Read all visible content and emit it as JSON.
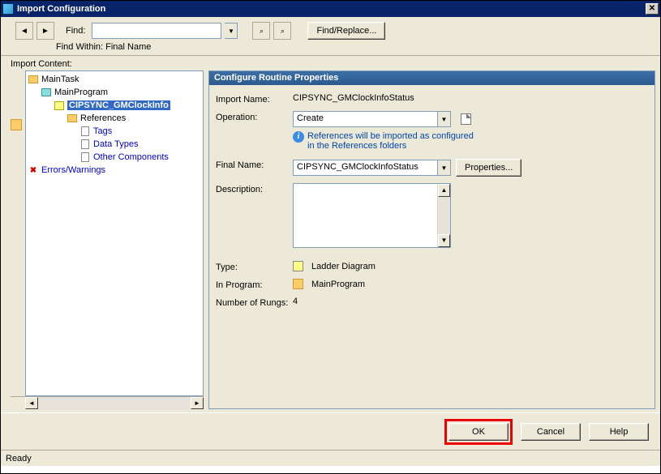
{
  "window": {
    "title": "Import Configuration"
  },
  "toolbar": {
    "find_label": "Find:",
    "find_value": "",
    "find_replace_btn": "Find/Replace...",
    "find_within": "Find Within: Final Name"
  },
  "left": {
    "label": "Import Content:",
    "tree": {
      "main_task": "MainTask",
      "main_program": "MainProgram",
      "selected_routine": "CIPSYNC_GMClockInfo",
      "references": "References",
      "tags": "Tags",
      "data_types": "Data Types",
      "other_components": "Other Components",
      "errors_warnings": "Errors/Warnings"
    }
  },
  "panel": {
    "header": "Configure Routine Properties",
    "import_name_label": "Import Name:",
    "import_name_value": "CIPSYNC_GMClockInfoStatus",
    "operation_label": "Operation:",
    "operation_value": "Create",
    "info_msg": "References will be imported as configured in the References folders",
    "final_name_label": "Final Name:",
    "final_name_value": "CIPSYNC_GMClockInfoStatus",
    "properties_btn": "Properties...",
    "description_label": "Description:",
    "description_value": "",
    "type_label": "Type:",
    "type_value": "Ladder Diagram",
    "in_program_label": "In Program:",
    "in_program_value": "MainProgram",
    "rungs_label": "Number of Rungs:",
    "rungs_value": "4"
  },
  "buttons": {
    "ok": "OK",
    "cancel": "Cancel",
    "help": "Help"
  },
  "status": {
    "text": "Ready"
  }
}
